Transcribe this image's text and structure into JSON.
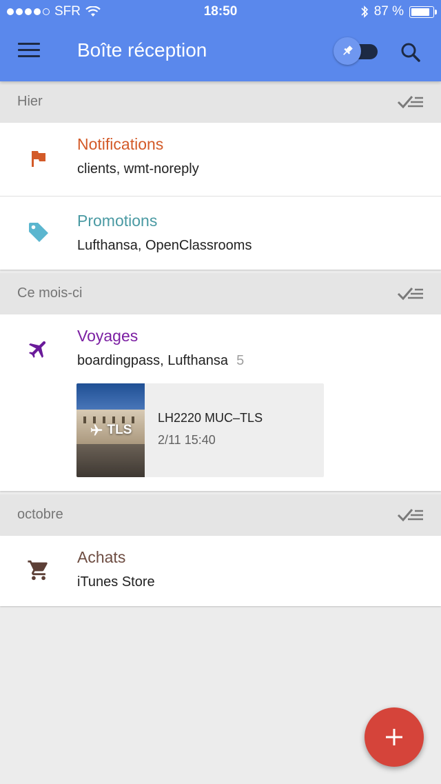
{
  "status_bar": {
    "carrier": "SFR",
    "time": "18:50",
    "battery_text": "87 %",
    "battery_level": 0.87
  },
  "app_bar": {
    "title": "Boîte réception",
    "pin_toggle_on": false
  },
  "sections": [
    {
      "label": "Hier",
      "bundles": [
        {
          "title": "Notifications",
          "senders": "clients, wmt-noreply",
          "color": "#d35a28",
          "icon": "flag-icon"
        },
        {
          "title": "Promotions",
          "senders": "Lufthansa, OpenClassrooms",
          "color": "#4a9aa3",
          "icon": "tag-icon"
        }
      ]
    },
    {
      "label": "Ce mois-ci",
      "bundles": [
        {
          "title": "Voyages",
          "senders": "boardingpass, Lufthansa",
          "count": "5",
          "color": "#7b1fa2",
          "icon": "airplane-icon",
          "trip": {
            "thumb_label": "TLS",
            "flight": "LH2220 MUC–TLS",
            "datetime": "2/11 15:40"
          }
        }
      ]
    },
    {
      "label": "octobre",
      "bundles": [
        {
          "title": "Achats",
          "senders": "iTunes Store",
          "color": "#6d4c41",
          "icon": "shopping-cart-icon"
        }
      ]
    }
  ],
  "colors": {
    "app_bar": "#5a88ec",
    "fab": "#d5443a"
  },
  "fab": {
    "icon": "plus-icon"
  }
}
